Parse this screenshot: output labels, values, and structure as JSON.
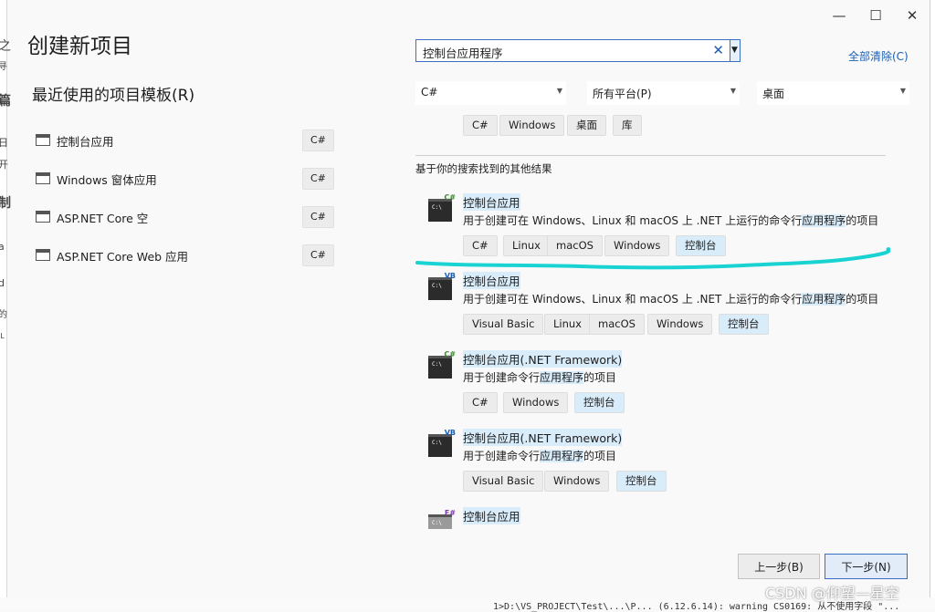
{
  "dialog": {
    "title": "创建新项目",
    "recent_heading": "最近使用的项目模板(R)",
    "window_controls": [
      "minimize-icon",
      "maximize-icon",
      "close-icon"
    ]
  },
  "recent_templates": [
    {
      "label": "控制台应用",
      "tag": "C#"
    },
    {
      "label": "Windows 窗体应用",
      "tag": "C#"
    },
    {
      "label": "ASP.NET Core 空",
      "tag": "C#"
    },
    {
      "label": "ASP.NET Core Web 应用",
      "tag": "C#"
    }
  ],
  "search": {
    "value": "控制台应用程序",
    "clear_all": "全部清除(C)"
  },
  "filters": {
    "language": "C#",
    "platform": "所有平台(P)",
    "project_type": "桌面"
  },
  "top_partial_tags": [
    "C#",
    "Windows",
    "桌面",
    "库"
  ],
  "other_results_label": "基于你的搜索找到的其他结果",
  "results": [
    {
      "badge": "C#",
      "name": "控制台应用",
      "desc_pre": "用于创建可在 Windows、Linux 和 macOS 上 .NET 上运行的命令行",
      "desc_hl": "应用程序",
      "desc_post": "的项目",
      "tags": [
        "C#",
        "Linux",
        "macOS",
        "Windows",
        "控制台"
      ]
    },
    {
      "badge": "VB",
      "name": "控制台应用",
      "desc_pre": "用于创建可在 Windows、Linux 和 macOS 上 .NET 上运行的命令行",
      "desc_hl": "应用程序",
      "desc_post": "的项目",
      "tags": [
        "Visual Basic",
        "Linux",
        "macOS",
        "Windows",
        "控制台"
      ]
    },
    {
      "badge": "C#",
      "name": "控制台应用(.NET Framework)",
      "desc_pre": "用于创建命令行",
      "desc_hl": "应用程序",
      "desc_post": "的项目",
      "tags": [
        "C#",
        "Windows",
        "控制台"
      ]
    },
    {
      "badge": "VB",
      "name": "控制台应用(.NET Framework)",
      "desc_pre": "用于创建命令行",
      "desc_hl": "应用程序",
      "desc_post": "的项目",
      "tags": [
        "Visual Basic",
        "Windows",
        "控制台"
      ]
    },
    {
      "badge": "F#",
      "name": "控制台应用"
    }
  ],
  "buttons": {
    "back": "上一步(B)",
    "next": "下一步(N)"
  },
  "watermark": "CSDN @仰望—星空",
  "background_text": {
    "bottom": "1>D:\\VS_PROJECT\\Test\\...\\P...   (6.12.6.14): warning CS0169: 从不使用字段 \"...",
    "left_chars": [
      "之",
      "寻",
      "篇",
      "日",
      "开",
      "制",
      "a",
      "d",
      "的",
      "IL"
    ]
  },
  "colors": {
    "accent": "#1a5fb4",
    "highlight": "#d9ecfa",
    "annotation_stroke": "#19d3d3"
  }
}
